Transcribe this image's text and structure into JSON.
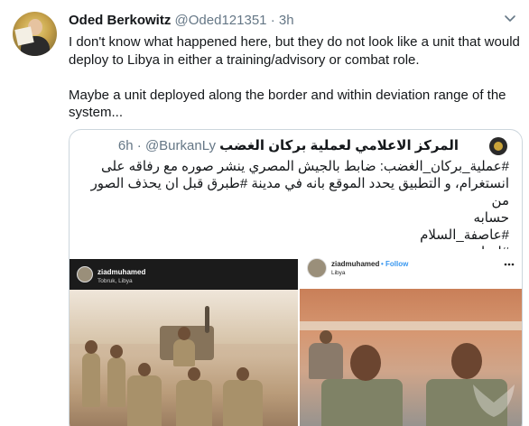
{
  "tweet": {
    "author_name": "Oded Berkowitz",
    "author_handle": "@Oded121351",
    "separator": "·",
    "time": "3h",
    "body": [
      "I don't know what happened here, but they do not look like a unit that would deploy to Libya in either a training/advisory or combat role.",
      "Maybe a unit deployed along the border and within deviation range of the system..."
    ]
  },
  "quote": {
    "name": "المركز الاعلامي لعملية بركان الغضب",
    "handle": "@BurkanLy",
    "separator": "·",
    "time": "6h",
    "lines": [
      "#عملية_بركان_الغضب: ضابط بالجيش المصري ينشر صوره مع رفاقه على",
      "انستغرام، و التطبيق يحدد الموقع بانه في مدينة #طبرق قبل ان يحذف الصور من",
      "حسابه",
      "#عاصفة_السلام",
      "#ليبيا"
    ]
  },
  "photos": [
    {
      "username": "ziadmuhamed",
      "location": "Tobruk, Libya"
    },
    {
      "username": "ziadmuhamed",
      "follow_label": "• Follow",
      "location": "Libya"
    }
  ],
  "icons": {
    "caret": "chevron-down-icon",
    "more": "more-icon"
  },
  "colors": {
    "text": "#14171a",
    "muted": "#657786",
    "border": "#ccd6dd",
    "link": "#1da1f2"
  }
}
